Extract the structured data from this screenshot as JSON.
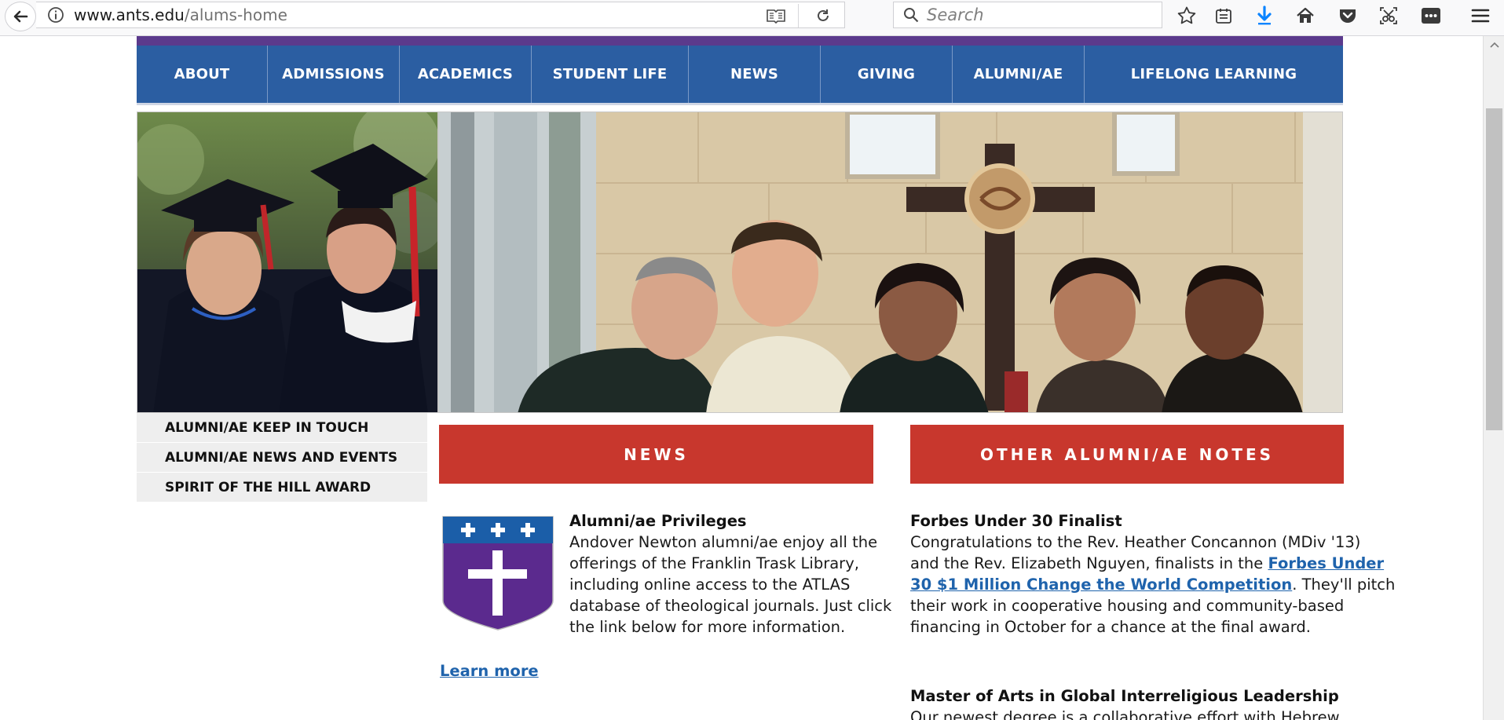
{
  "browser": {
    "url_domain": "www.ants.edu",
    "url_path": "/alums-home",
    "search_placeholder": "Search",
    "icons": [
      "back-icon",
      "info-icon",
      "reader-view-icon",
      "reload-icon",
      "search-icon",
      "bookmark-star-icon",
      "reading-list-icon",
      "downloads-icon",
      "home-icon",
      "pocket-icon",
      "screenshot-icon",
      "more-tools-icon",
      "menu-icon"
    ]
  },
  "colors": {
    "nav_blue": "#2b5ea2",
    "purple": "#5b3a8c",
    "banner_red": "#c8372d",
    "link_blue": "#1f63ac"
  },
  "nav": {
    "items": [
      "ABOUT",
      "ADMISSIONS",
      "ACADEMICS",
      "STUDENT LIFE",
      "NEWS",
      "GIVING",
      "ALUMNI/AE",
      "LIFELONG LEARNING"
    ]
  },
  "sidebar": {
    "items": [
      "ALUMNI/AE KEEP IN TOUCH",
      "ALUMNI/AE NEWS AND EVENTS",
      "SPIRIT OF THE HILL AWARD"
    ]
  },
  "news": {
    "heading": "NEWS",
    "article": {
      "title": "Alumni/ae Privileges",
      "lines": [
        "Andover Newton alumni/ae enjoy all the",
        "offerings of the Franklin Trask Library,",
        "including online access to the ATLAS",
        "database of theological journals. Just click",
        "the link below for more information."
      ],
      "link": "Learn more"
    }
  },
  "other_notes": {
    "heading": "OTHER ALUMNI/AE NOTES",
    "item1": {
      "title": "Forbes Under 30 Finalist",
      "line1": "Congratulations to the Rev. Heather Concannon (MDiv '13)",
      "line2_pre": "and the Rev. Elizabeth Nguyen, finalists in the ",
      "link_part1": "Forbes Under",
      "link_part2": "30 $1 Million Change the World Competition",
      "line3_post": ". They'll pitch",
      "line4": "their work in cooperative housing and community-based",
      "line5": "financing in October for a chance at the final award."
    },
    "item2": {
      "title": "Master of Arts in Global Interreligious Leadership",
      "line1": "Our newest degree is a collaborative effort with Hebrew"
    }
  }
}
